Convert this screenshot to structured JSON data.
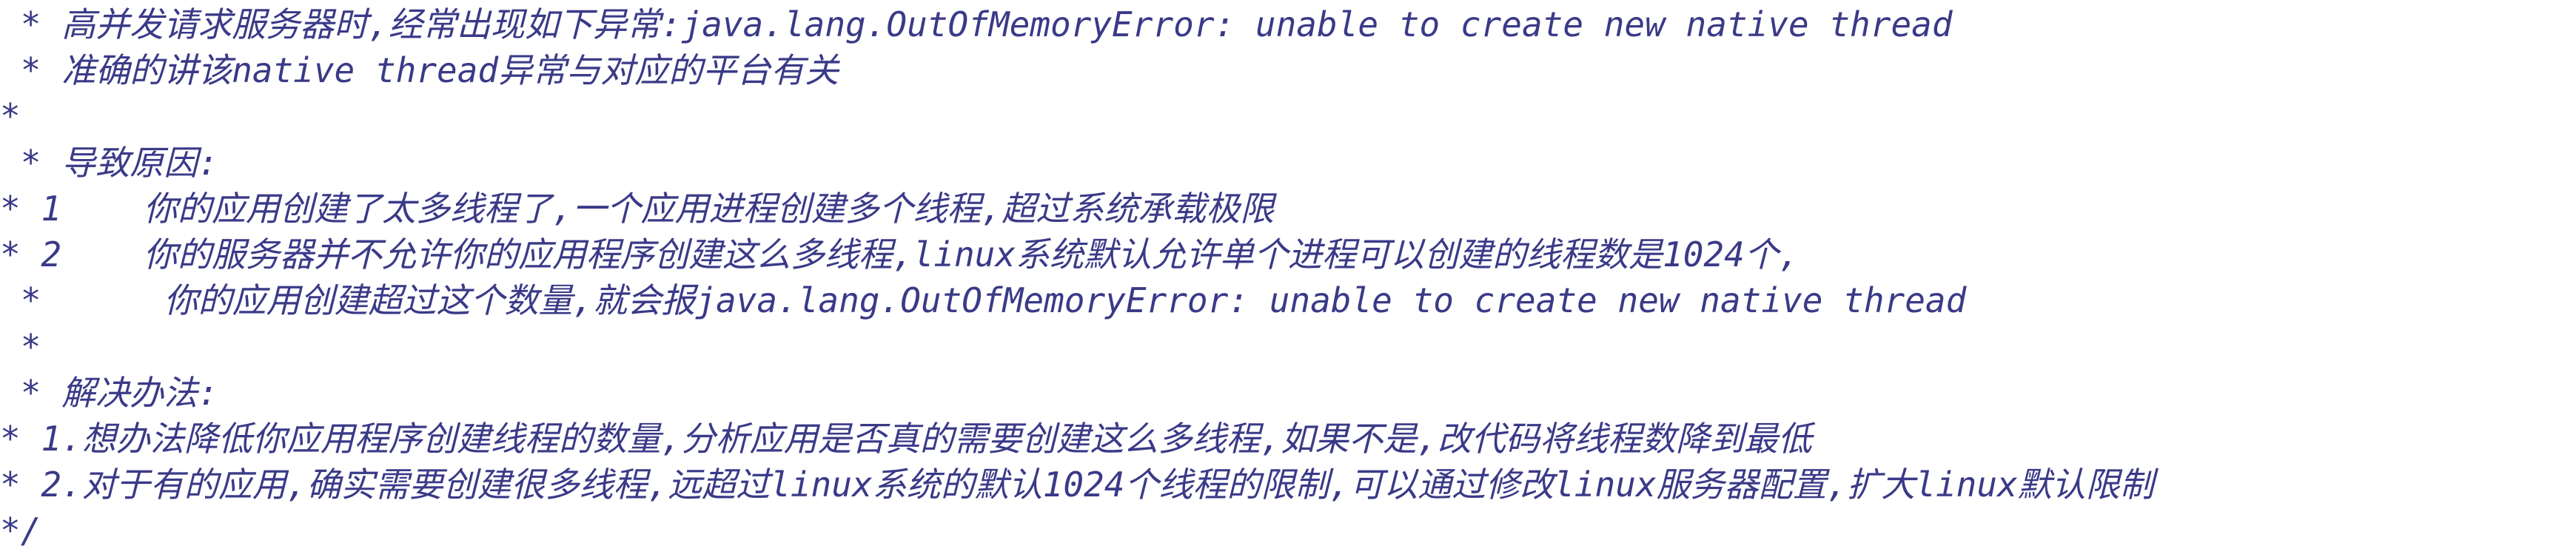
{
  "editor": {
    "text_color": "#3a3a88",
    "background": "#ffffff",
    "lines": [
      " * 高并发请求服务器时,经常出现如下异常:java.lang.OutOfMemoryError: unable to create new native thread",
      " * 准确的讲该native thread异常与对应的平台有关",
      "*",
      " * 导致原因:",
      "* 1    你的应用创建了太多线程了,一个应用进程创建多个线程,超过系统承载极限",
      "* 2    你的服务器并不允许你的应用程序创建这么多线程,linux系统默认允许单个进程可以创建的线程数是1024个,",
      " *      你的应用创建超过这个数量,就会报java.lang.OutOfMemoryError: unable to create new native thread",
      " *",
      " * 解决办法:",
      "* 1.想办法降低你应用程序创建线程的数量,分析应用是否真的需要创建这么多线程,如果不是,改代码将线程数降到最低",
      "* 2.对于有的应用,确实需要创建很多线程,远超过linux系统的默认1024个线程的限制,可以通过修改linux服务器配置,扩大linux默认限制",
      "*/"
    ]
  }
}
